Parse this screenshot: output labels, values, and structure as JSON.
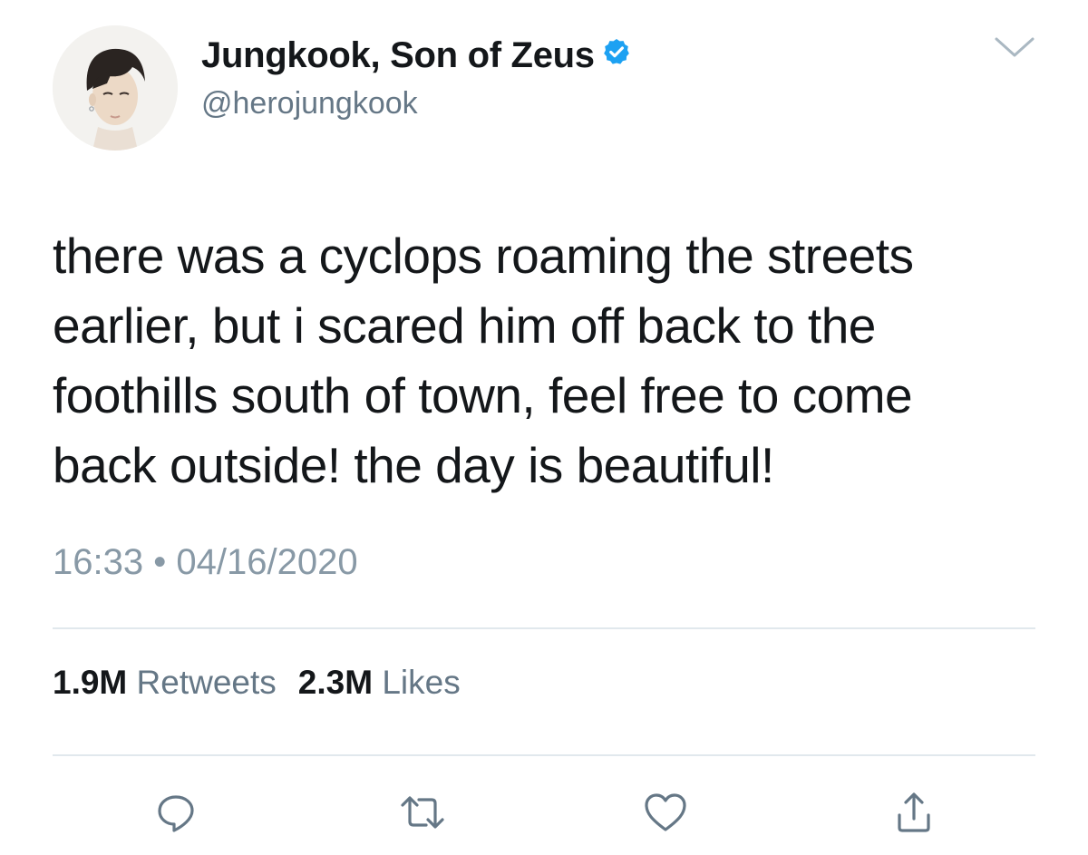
{
  "author": {
    "display_name": "Jungkook, Son of Zeus",
    "handle": "@herojungkook",
    "verified": true,
    "avatar_icon": "profile-photo"
  },
  "menu": {
    "icon": "chevron-down-icon"
  },
  "tweet": {
    "lines": [
      "there was a cyclops roaming the streets",
      "earlier, but i scared him off back to the",
      "foothills south of town, feel free to come",
      "back outside! the day is beautiful!"
    ],
    "time": "16:33",
    "separator": "•",
    "date": "04/16/2020"
  },
  "stats": {
    "retweets_count": "1.9M",
    "retweets_label": "Retweets",
    "likes_count": "2.3M",
    "likes_label": "Likes"
  },
  "actions": [
    {
      "name": "reply",
      "icon": "reply-icon"
    },
    {
      "name": "retweet",
      "icon": "retweet-icon"
    },
    {
      "name": "like",
      "icon": "heart-icon"
    },
    {
      "name": "share",
      "icon": "share-icon"
    }
  ],
  "colors": {
    "text_primary": "#14171a",
    "text_secondary": "#657786",
    "timestamp": "#8899a6",
    "verified_blue": "#1da1f2",
    "icon_gray": "#657786",
    "divider": "#e1e8ed"
  }
}
